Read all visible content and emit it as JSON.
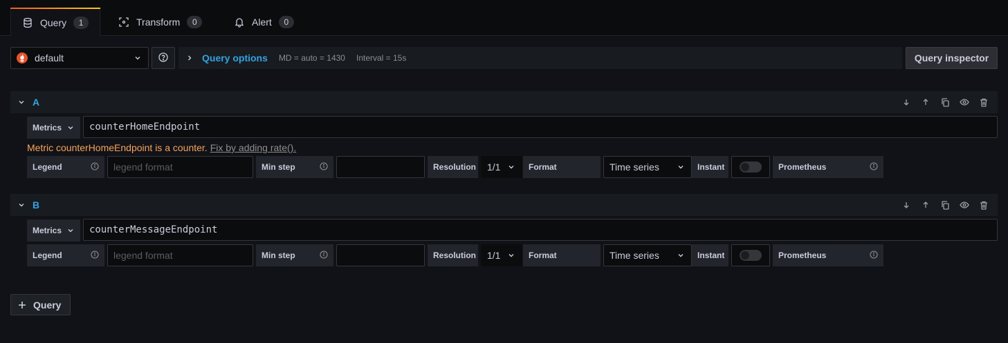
{
  "tabs": [
    {
      "label": "Query",
      "count": "1",
      "icon": "database-icon"
    },
    {
      "label": "Transform",
      "count": "0",
      "icon": "transform-icon"
    },
    {
      "label": "Alert",
      "count": "0",
      "icon": "bell-icon"
    }
  ],
  "datasource": {
    "value": "default",
    "icon": "prometheus-logo"
  },
  "query_options": {
    "title": "Query options",
    "md": "MD = auto = 1430",
    "interval": "Interval = 15s"
  },
  "query_inspector_label": "Query inspector",
  "queries": [
    {
      "ref_id": "A",
      "metrics_label": "Metrics",
      "metrics_value": "counterHomeEndpoint",
      "warning_text": "Metric counterHomeEndpoint is a counter.",
      "warning_fix": "Fix by adding rate().",
      "legend_label": "Legend",
      "legend_placeholder": "legend format",
      "min_step_label": "Min step",
      "min_step_value": "",
      "resolution_label": "Resolution",
      "resolution_value": "1/1",
      "format_label": "Format",
      "format_value": "Time series",
      "instant_label": "Instant",
      "instant_on": false,
      "prometheus_label": "Prometheus"
    },
    {
      "ref_id": "B",
      "metrics_label": "Metrics",
      "metrics_value": "counterMessageEndpoint",
      "legend_label": "Legend",
      "legend_placeholder": "legend format",
      "min_step_label": "Min step",
      "min_step_value": "",
      "resolution_label": "Resolution",
      "resolution_value": "1/1",
      "format_label": "Format",
      "format_value": "Time series",
      "instant_label": "Instant",
      "instant_on": false,
      "prometheus_label": "Prometheus"
    }
  ],
  "add_query_label": "Query",
  "colors": {
    "accent_blue": "#33a2e5",
    "warning": "#f5a35c",
    "tab_gradient_start": "#f05a28",
    "tab_gradient_end": "#fbca0a"
  }
}
